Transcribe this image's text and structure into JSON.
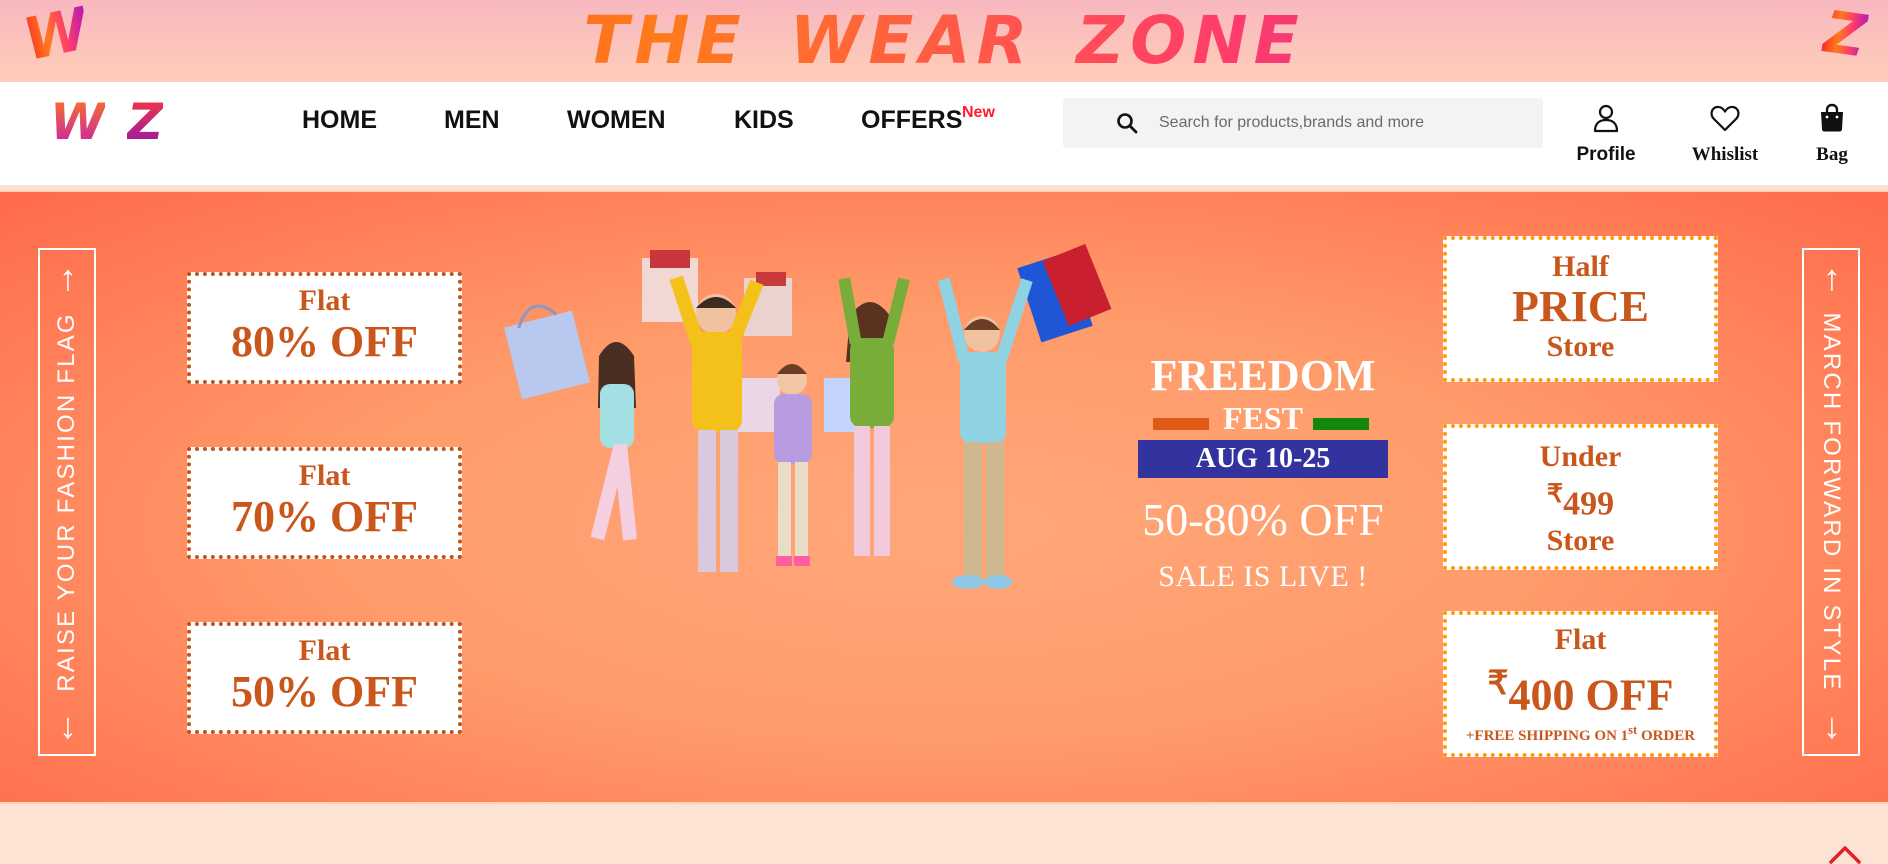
{
  "brand": {
    "title": "THE WEAR ZONE",
    "corner_left": "W",
    "corner_right": "Z",
    "logo_left": "W",
    "logo_right": "Z"
  },
  "nav": {
    "links": [
      "HOME",
      "MEN",
      "WOMEN",
      "KIDS",
      "OFFERS"
    ],
    "offers_badge": "New"
  },
  "search": {
    "placeholder": "Search for products,brands and more"
  },
  "actions": {
    "profile": "Profile",
    "wishlist": "Whislist",
    "bag": "Bag"
  },
  "hero": {
    "left_flag": "RAISE YOUR FASHION FLAG",
    "right_flag": "MARCH FORWARD IN STYLE",
    "left_offers": [
      {
        "line1": "Flat",
        "line2": "80% OFF"
      },
      {
        "line1": "Flat",
        "line2": "70% OFF"
      },
      {
        "line1": "Flat",
        "line2": "50% OFF"
      }
    ],
    "right_offers": {
      "half": {
        "top": "Half",
        "middle": "PRICE",
        "bottom": "Store"
      },
      "under": {
        "top": "Under",
        "rupee": "₹",
        "amount": "499",
        "bottom": "Store"
      },
      "flat400": {
        "top": "Flat",
        "rupee": "₹",
        "amount": "400 OFF",
        "note_prefix": "+FREE SHIPPING ON 1",
        "note_sup": "st",
        "note_suffix": " ORDER"
      }
    },
    "fest": {
      "title": "FREEDOM",
      "subtitle": "FEST",
      "date": "AUG 10-25",
      "discount": "50-80% OFF",
      "status": "SALE IS LIVE !"
    }
  },
  "colors": {
    "offer_text": "#c9561a",
    "date_bg": "#3333a0",
    "saffron": "#e05a16",
    "green": "#138808",
    "badge": "#ff1b2d"
  }
}
